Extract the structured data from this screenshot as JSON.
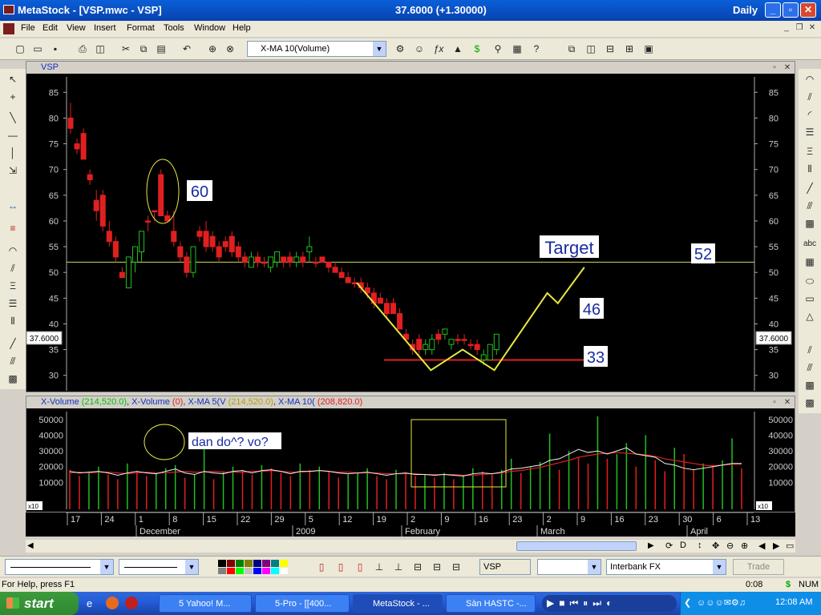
{
  "app": {
    "title": "MetaStock - [VSP.mwc - VSP]",
    "price_display": "37.6000 (+1.30000)",
    "periodicity": "Daily"
  },
  "menu": [
    "File",
    "Edit",
    "View",
    "Insert",
    "Format",
    "Tools",
    "Window",
    "Help"
  ],
  "toolbar": {
    "indicator_combo": "X-MA 10(Volume)"
  },
  "price_window": {
    "title": "VSP",
    "current_price_tag": "37.6000",
    "annotations": {
      "circled_level": "60",
      "target_label": "Target",
      "target_level": "52",
      "level_46": "46",
      "support_level": "33"
    }
  },
  "volume_window": {
    "title_parts": {
      "xvol1": "X-Volume",
      "xvol1_val": "(214,520.0)",
      "xvol2": ", X-Volume",
      "xvol2_val": "(0)",
      "xma5": ", X-MA 5(V",
      "xma5_val": "(214,520.0)",
      "xma10": ", X-MA 10(",
      "xma10_val": "(208,820.0)"
    },
    "note": "dan do^? vo?",
    "scale_tag": "x10"
  },
  "date_axis": {
    "days": [
      "17",
      "24",
      "1",
      "8",
      "15",
      "22",
      "29",
      "5",
      "12",
      "19",
      "2",
      "9",
      "16",
      "23",
      "2",
      "9",
      "16",
      "23",
      "30",
      "6",
      "13"
    ],
    "months": [
      "December",
      "2009",
      "February",
      "March",
      "April"
    ]
  },
  "bottom_toolbar": {
    "symbol": "VSP",
    "source": "Interbank FX",
    "trade": "Trade"
  },
  "status": {
    "help": "For Help, press F1",
    "time": "0:08",
    "dollar": "$",
    "num": "NUM"
  },
  "taskbar": {
    "start": "start",
    "tasks": [
      "5 Yahoo! M...",
      "5-Pro - [[400...",
      "MetaStock - ...",
      "Sàn HASTC -..."
    ],
    "clock": "12:08 AM"
  },
  "chart_data": [
    {
      "type": "candlestick",
      "title": "VSP",
      "ylim": [
        27,
        88
      ],
      "y_ticks": [
        30,
        35,
        40,
        45,
        50,
        55,
        60,
        65,
        70,
        75,
        80,
        85
      ],
      "horizontal_lines": [
        {
          "value": 52,
          "color": "#d8d860"
        },
        {
          "value": 33,
          "color": "#e02020"
        }
      ],
      "candles": [
        {
          "o": 80,
          "h": 83,
          "l": 77,
          "c": 78,
          "up": false
        },
        {
          "o": 75,
          "h": 76,
          "l": 73,
          "c": 74,
          "up": false
        },
        {
          "o": 77,
          "h": 78,
          "l": 72,
          "c": 72,
          "up": false
        },
        {
          "o": 69,
          "h": 70,
          "l": 67,
          "c": 68,
          "up": false
        },
        {
          "o": 64,
          "h": 66,
          "l": 60,
          "c": 62,
          "up": false
        },
        {
          "o": 65,
          "h": 66,
          "l": 58,
          "c": 59,
          "up": false
        },
        {
          "o": 58,
          "h": 60,
          "l": 55,
          "c": 56,
          "up": false
        },
        {
          "o": 56,
          "h": 57,
          "l": 52,
          "c": 53,
          "up": false
        },
        {
          "o": 50,
          "h": 51,
          "l": 49,
          "c": 49,
          "up": false
        },
        {
          "o": 47,
          "h": 53,
          "l": 47,
          "c": 53,
          "up": true
        },
        {
          "o": 52,
          "h": 55,
          "l": 50,
          "c": 55,
          "up": true
        },
        {
          "o": 54,
          "h": 58,
          "l": 52,
          "c": 58,
          "up": true
        },
        {
          "o": 60,
          "h": 61,
          "l": 58,
          "c": 60,
          "up": false
        },
        {
          "o": 62,
          "h": 62,
          "l": 60,
          "c": 62,
          "up": false
        },
        {
          "o": 69,
          "h": 70,
          "l": 61,
          "c": 61,
          "up": false
        },
        {
          "o": 61,
          "h": 62,
          "l": 60,
          "c": 60,
          "up": false
        },
        {
          "o": 58,
          "h": 62,
          "l": 55,
          "c": 56,
          "up": false
        },
        {
          "o": 55,
          "h": 56,
          "l": 52,
          "c": 53,
          "up": false
        },
        {
          "o": 53,
          "h": 54,
          "l": 49,
          "c": 50,
          "up": false
        },
        {
          "o": 50,
          "h": 55,
          "l": 49,
          "c": 55,
          "up": true
        },
        {
          "o": 58,
          "h": 59,
          "l": 56,
          "c": 57,
          "up": false
        },
        {
          "o": 58,
          "h": 60,
          "l": 54,
          "c": 55,
          "up": false
        },
        {
          "o": 57,
          "h": 58,
          "l": 54,
          "c": 55,
          "up": false
        },
        {
          "o": 55,
          "h": 56,
          "l": 52,
          "c": 53,
          "up": false
        },
        {
          "o": 56,
          "h": 57,
          "l": 54,
          "c": 55,
          "up": false
        },
        {
          "o": 57,
          "h": 58,
          "l": 53,
          "c": 54,
          "up": false
        },
        {
          "o": 55,
          "h": 56,
          "l": 52,
          "c": 53,
          "up": false
        },
        {
          "o": 53,
          "h": 54,
          "l": 51,
          "c": 52,
          "up": false
        },
        {
          "o": 51,
          "h": 54,
          "l": 51,
          "c": 53,
          "up": true
        },
        {
          "o": 53,
          "h": 54,
          "l": 51,
          "c": 52,
          "up": false
        },
        {
          "o": 52,
          "h": 53,
          "l": 51,
          "c": 52,
          "up": false
        },
        {
          "o": 51,
          "h": 53,
          "l": 50,
          "c": 53,
          "up": true
        },
        {
          "o": 52,
          "h": 54,
          "l": 51,
          "c": 54,
          "up": true
        },
        {
          "o": 53,
          "h": 53,
          "l": 51,
          "c": 52,
          "up": false
        },
        {
          "o": 53,
          "h": 54,
          "l": 51,
          "c": 52,
          "up": false
        },
        {
          "o": 52,
          "h": 54,
          "l": 51,
          "c": 53,
          "up": true
        },
        {
          "o": 53,
          "h": 54,
          "l": 51,
          "c": 52,
          "up": false
        },
        {
          "o": 54,
          "h": 57,
          "l": 52,
          "c": 55,
          "up": true
        },
        {
          "o": 52,
          "h": 53,
          "l": 51,
          "c": 52,
          "up": false
        },
        {
          "o": 53,
          "h": 53,
          "l": 52,
          "c": 52,
          "up": false
        },
        {
          "o": 52,
          "h": 52,
          "l": 50,
          "c": 51,
          "up": false
        },
        {
          "o": 51,
          "h": 52,
          "l": 50,
          "c": 50,
          "up": false
        },
        {
          "o": 50,
          "h": 51,
          "l": 49,
          "c": 49,
          "up": false
        },
        {
          "o": 49,
          "h": 50,
          "l": 48,
          "c": 48,
          "up": false
        },
        {
          "o": 48,
          "h": 49,
          "l": 47,
          "c": 48,
          "up": false
        },
        {
          "o": 48,
          "h": 49,
          "l": 46,
          "c": 47,
          "up": false
        },
        {
          "o": 47,
          "h": 48,
          "l": 45,
          "c": 46,
          "up": false
        },
        {
          "o": 46,
          "h": 47,
          "l": 43,
          "c": 44,
          "up": false
        },
        {
          "o": 45,
          "h": 46,
          "l": 44,
          "c": 44,
          "up": false
        },
        {
          "o": 44,
          "h": 45,
          "l": 41,
          "c": 42,
          "up": false
        },
        {
          "o": 44,
          "h": 45,
          "l": 42,
          "c": 42,
          "up": false
        },
        {
          "o": 42,
          "h": 43,
          "l": 39,
          "c": 39,
          "up": false
        },
        {
          "o": 38,
          "h": 39,
          "l": 37,
          "c": 37,
          "up": false
        },
        {
          "o": 36,
          "h": 37,
          "l": 34,
          "c": 35,
          "up": false
        },
        {
          "o": 37,
          "h": 38,
          "l": 34,
          "c": 35,
          "up": false
        },
        {
          "o": 35,
          "h": 37,
          "l": 34,
          "c": 36,
          "up": true
        },
        {
          "o": 35,
          "h": 38,
          "l": 34,
          "c": 37,
          "up": true
        },
        {
          "o": 37,
          "h": 39,
          "l": 36,
          "c": 38,
          "up": false
        },
        {
          "o": 38,
          "h": 39,
          "l": 37,
          "c": 39,
          "up": true
        },
        {
          "o": 36,
          "h": 37,
          "l": 35,
          "c": 37,
          "up": true
        },
        {
          "o": 37,
          "h": 38,
          "l": 36,
          "c": 37,
          "up": false
        },
        {
          "o": 37,
          "h": 38,
          "l": 36,
          "c": 37,
          "up": false
        },
        {
          "o": 36,
          "h": 37,
          "l": 35,
          "c": 36,
          "up": false
        },
        {
          "o": 36,
          "h": 37,
          "l": 34,
          "c": 35,
          "up": false
        },
        {
          "o": 33,
          "h": 35,
          "l": 32,
          "c": 34,
          "up": true
        },
        {
          "o": 33,
          "h": 36,
          "l": 33,
          "c": 36,
          "up": true
        },
        {
          "o": 35,
          "h": 38,
          "l": 34,
          "c": 38,
          "up": true
        }
      ],
      "projection_path": [
        {
          "x": 0,
          "y": 48
        },
        {
          "x": 14,
          "y": 31
        },
        {
          "x": 20,
          "y": 35
        },
        {
          "x": 26,
          "y": 31
        },
        {
          "x": 36,
          "y": 46
        },
        {
          "x": 38,
          "y": 44
        },
        {
          "x": 43,
          "y": 51
        }
      ]
    },
    {
      "type": "bar+line",
      "title": "X-Volume",
      "ylim": [
        0,
        55000
      ],
      "y_ticks": [
        10000,
        20000,
        30000,
        40000,
        50000
      ],
      "volume": [
        18000,
        14000,
        16000,
        20000,
        15000,
        12000,
        22000,
        17000,
        14000,
        16000,
        19000,
        21000,
        13000,
        15000,
        40000,
        12000,
        17000,
        20000,
        18000,
        15000,
        21000,
        19000,
        16000,
        14000,
        22000,
        18000,
        20000,
        17000,
        13000,
        15000,
        16000,
        19000,
        14000,
        12000,
        18000,
        16000,
        14000,
        15000,
        13000,
        16000,
        12000,
        14000,
        19000,
        17000,
        15000,
        18000,
        25000,
        16000,
        20000,
        23000,
        41000,
        18000,
        30000,
        26000,
        22000,
        52000,
        25000,
        28000,
        35000,
        20000,
        40000,
        24000,
        17000,
        32000,
        28000,
        18000,
        22000,
        20000,
        24000,
        38000,
        19000
      ],
      "ma5": [
        17000,
        16000,
        16500,
        17000,
        16000,
        14500,
        16000,
        17000,
        16000,
        15500,
        17000,
        18500,
        16000,
        15000,
        17000,
        16000,
        15500,
        17000,
        17500,
        16000,
        17500,
        18000,
        17000,
        15500,
        17000,
        17000,
        17500,
        17000,
        16000,
        15500,
        16000,
        16500,
        15500,
        14500,
        15500,
        16000,
        15000,
        15000,
        14500,
        15000,
        14500,
        14000,
        15500,
        16000,
        15500,
        16500,
        18500,
        19000,
        20000,
        21000,
        24000,
        25000,
        28000,
        31000,
        29000,
        30000,
        28000,
        30000,
        32000,
        28000,
        27000,
        26000,
        22000,
        21000,
        19000,
        18000,
        19000,
        20000,
        21000,
        22000,
        22000
      ],
      "ma10": [
        16000,
        16500,
        16000,
        16500,
        16500,
        16000,
        15500,
        16000,
        16500,
        16000,
        16000,
        16500,
        17000,
        16500,
        16500,
        17000,
        16500,
        16500,
        16500,
        17000,
        17000,
        17500,
        17000,
        16500,
        16500,
        17000,
        17500,
        17000,
        16500,
        16500,
        16000,
        16000,
        16000,
        15500,
        15500,
        15500,
        15500,
        15000,
        15000,
        15000,
        15000,
        14500,
        14500,
        15000,
        15500,
        16000,
        17000,
        17500,
        18500,
        19500,
        21000,
        22500,
        24000,
        26000,
        27000,
        28000,
        28500,
        29000,
        28500,
        28000,
        27500,
        26500,
        25000,
        24000,
        23000,
        22000,
        21000,
        20500,
        21000,
        21500,
        21500
      ]
    }
  ],
  "colors": {
    "chart_bg": "#000000",
    "down_candle": "#e02020",
    "up_candle": "#20c020",
    "target_line": "#d8d860",
    "support_line": "#e02020",
    "projection": "#e8e840",
    "label_bg": "#ffffff",
    "label_text": "#1a2ba0"
  }
}
